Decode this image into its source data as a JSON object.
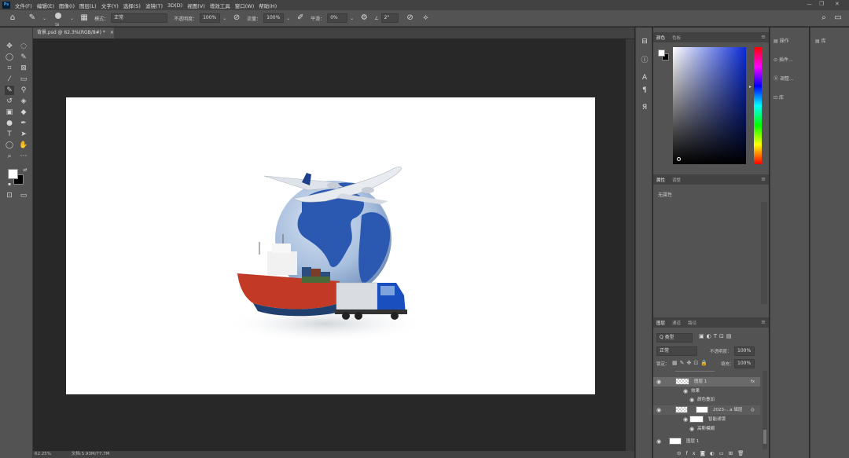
{
  "app": {
    "logo": "Ps"
  },
  "menu": [
    "文件(F)",
    "编辑(E)",
    "图像(I)",
    "图层(L)",
    "文字(Y)",
    "选择(S)",
    "滤镜(T)",
    "3D(D)",
    "视图(V)",
    "增效工具",
    "窗口(W)",
    "帮助(H)"
  ],
  "window_controls": {
    "minimize": "—",
    "restore": "❐",
    "close": "✕"
  },
  "options": {
    "brush_size": "56",
    "mode_label": "模式：",
    "mode_value": "正常",
    "opacity_label": "不透明度：",
    "opacity_value": "100%",
    "flow_label": "流量：",
    "flow_value": "100%",
    "smoothing_label": "平滑：",
    "smoothing_value": "0%",
    "angle_value": "2°"
  },
  "document": {
    "tab_title": "背景.psd @ 62.3%(RGB/8#) *",
    "close": "×"
  },
  "status": {
    "zoom": "62.25%",
    "doc_size": "文档:5.93M/77.7M"
  },
  "color_panel": {
    "tabs": [
      "颜色",
      "色板"
    ],
    "active": 0,
    "hue_color": "#0a2bd6"
  },
  "properties_panel": {
    "tabs": [
      "属性",
      "调整"
    ],
    "active": 0,
    "empty_text": "无属性"
  },
  "side_panel": {
    "items": [
      "操作",
      "图像",
      "调整",
      "库"
    ],
    "labels": [
      "插件",
      "插件...",
      "调整...",
      "库"
    ]
  },
  "layers_panel": {
    "tabs": [
      "图层",
      "通道",
      "路径"
    ],
    "active": 0,
    "filter_label": "Q 类型",
    "blend_mode": "正常",
    "opacity_label": "不透明度：",
    "opacity_value": "100%",
    "lock_label": "锁定：",
    "fill_label": "填充：",
    "fill_value": "100%",
    "layers": [
      {
        "name": "",
        "type": "partial"
      },
      {
        "name": "图层 1",
        "type": "layer",
        "fx": "fx"
      },
      {
        "name": "效果",
        "type": "effect-group"
      },
      {
        "name": "颜色叠加",
        "type": "effect"
      },
      {
        "name": "2023-...a 填层",
        "type": "smart"
      },
      {
        "name": "智能滤镜",
        "type": "smart-filter"
      },
      {
        "name": "高斯模糊",
        "type": "filter"
      },
      {
        "name": "图层 1",
        "type": "bottom"
      }
    ]
  }
}
